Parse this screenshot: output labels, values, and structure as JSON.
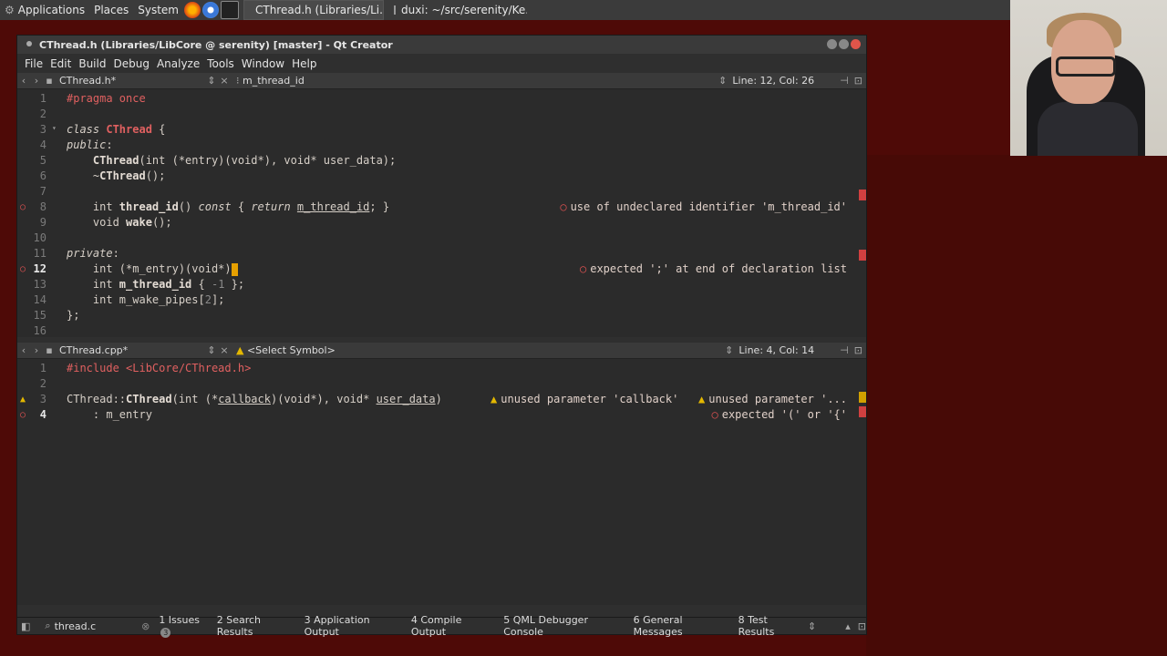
{
  "panel": {
    "applications": "Applications",
    "places": "Places",
    "system": "System",
    "tasks": [
      "CThread.h (Libraries/Li...",
      "duxi: ~/src/serenity/Ke..."
    ]
  },
  "window": {
    "title": "CThread.h (Libraries/LibCore @ serenity) [master] - Qt Creator",
    "menu": [
      "File",
      "Edit",
      "Build",
      "Debug",
      "Analyze",
      "Tools",
      "Window",
      "Help"
    ]
  },
  "top_editor": {
    "file": "CThread.h*",
    "symbol": "m_thread_id",
    "position": "Line: 12, Col: 26",
    "line_numbers": [
      "1",
      "2",
      "3",
      "4",
      "5",
      "6",
      "7",
      "8",
      "9",
      "10",
      "11",
      "12",
      "13",
      "14",
      "15",
      "16"
    ],
    "diag_line8": "use of undeclared identifier 'm_thread_id'",
    "diag_line12": "expected ';' at end of declaration list"
  },
  "bottom_editor": {
    "file": "CThread.cpp*",
    "symbol": "<Select Symbol>",
    "position": "Line: 4, Col: 14",
    "line_numbers": [
      "1",
      "2",
      "3",
      "4"
    ],
    "diag_line3a": "unused parameter 'callback'",
    "diag_line3b": "unused parameter '...",
    "diag_line4": "expected '(' or '{'"
  },
  "statusbar": {
    "locator": "thread.c",
    "tabs": [
      "1 Issues",
      "2 Search Results",
      "3 Application Output",
      "4 Compile Output",
      "5 QML Debugger Console",
      "6 General Messages",
      "8 Test Results"
    ],
    "issues_count": "3"
  }
}
